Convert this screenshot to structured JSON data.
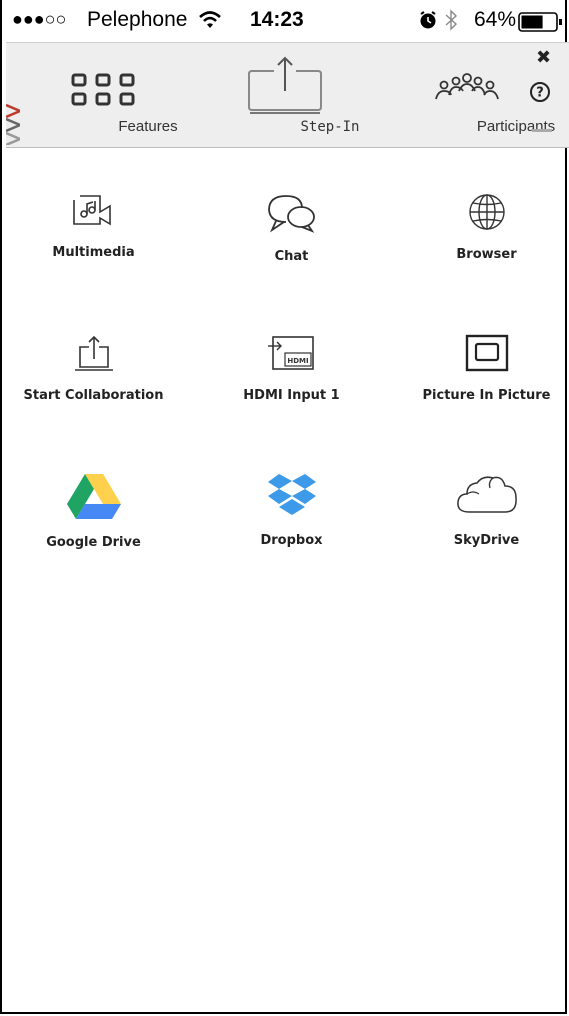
{
  "status_bar": {
    "signal": "●●●○○",
    "carrier": "Pelephone",
    "time": "14:23",
    "battery_percent": "64%",
    "battery_level": 0.64,
    "icons": [
      "wifi-icon",
      "alarm-icon",
      "bluetooth-icon",
      "battery-icon"
    ]
  },
  "toolbar": {
    "features_label": "Features",
    "stepin_label": "Step-In",
    "participants_label": "Participants",
    "close_glyph": "✖",
    "help_glyph": "?",
    "icons": [
      "grid-icon",
      "screen-upload-icon",
      "participants-icon",
      "close-icon",
      "help-icon",
      "minimize-icon"
    ]
  },
  "features": [
    {
      "label": "Multimedia",
      "icon": "multimedia-icon"
    },
    {
      "label": "Chat",
      "icon": "chat-icon"
    },
    {
      "label": "Browser",
      "icon": "globe-icon"
    },
    {
      "label": "Start Collaboration",
      "icon": "share-upload-icon"
    },
    {
      "label": "HDMI Input 1",
      "icon": "hdmi-icon",
      "icon_text": "HDMI"
    },
    {
      "label": "Picture In Picture",
      "icon": "picture-in-picture-icon"
    },
    {
      "label": "Google Drive",
      "icon": "google-drive-icon"
    },
    {
      "label": "Dropbox",
      "icon": "dropbox-icon"
    },
    {
      "label": "SkyDrive",
      "icon": "cloud-icon"
    }
  ],
  "colors": {
    "toolbar_bg": "#eeeeee",
    "logo_red": "#c0392b",
    "dropbox_blue": "#3d9ae8",
    "drive_green": "#1fa463",
    "drive_yellow": "#ffd04b",
    "drive_blue": "#4688f4"
  }
}
